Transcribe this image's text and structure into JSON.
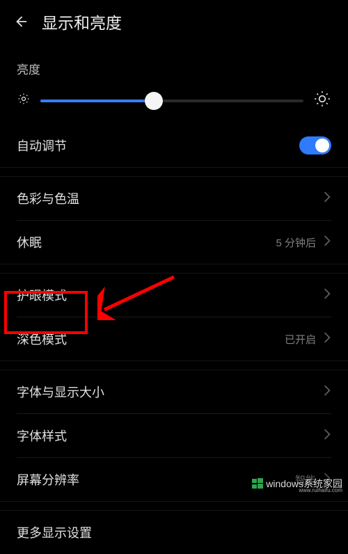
{
  "header": {
    "title": "显示和亮度"
  },
  "brightness": {
    "label": "亮度",
    "auto_adjust_label": "自动调节",
    "auto_adjust_on": true,
    "slider_percent": 43
  },
  "rows": {
    "color_temp": {
      "label": "色彩与色温"
    },
    "sleep": {
      "label": "休眠",
      "value": "5 分钟后"
    },
    "eye_comfort": {
      "label": "护眼模式"
    },
    "dark_mode": {
      "label": "深色模式",
      "value": "已开启"
    },
    "font_size": {
      "label": "字体与显示大小"
    },
    "font_style": {
      "label": "字体样式"
    },
    "resolution": {
      "label": "屏幕分辨率",
      "value": "智能"
    },
    "more": {
      "label": "更多显示设置"
    }
  },
  "watermark": {
    "text": "windows系统家园",
    "sub": "www.ruihaifu.com"
  },
  "colors": {
    "accent": "#2f7bfd",
    "highlight": "#ff0000"
  }
}
